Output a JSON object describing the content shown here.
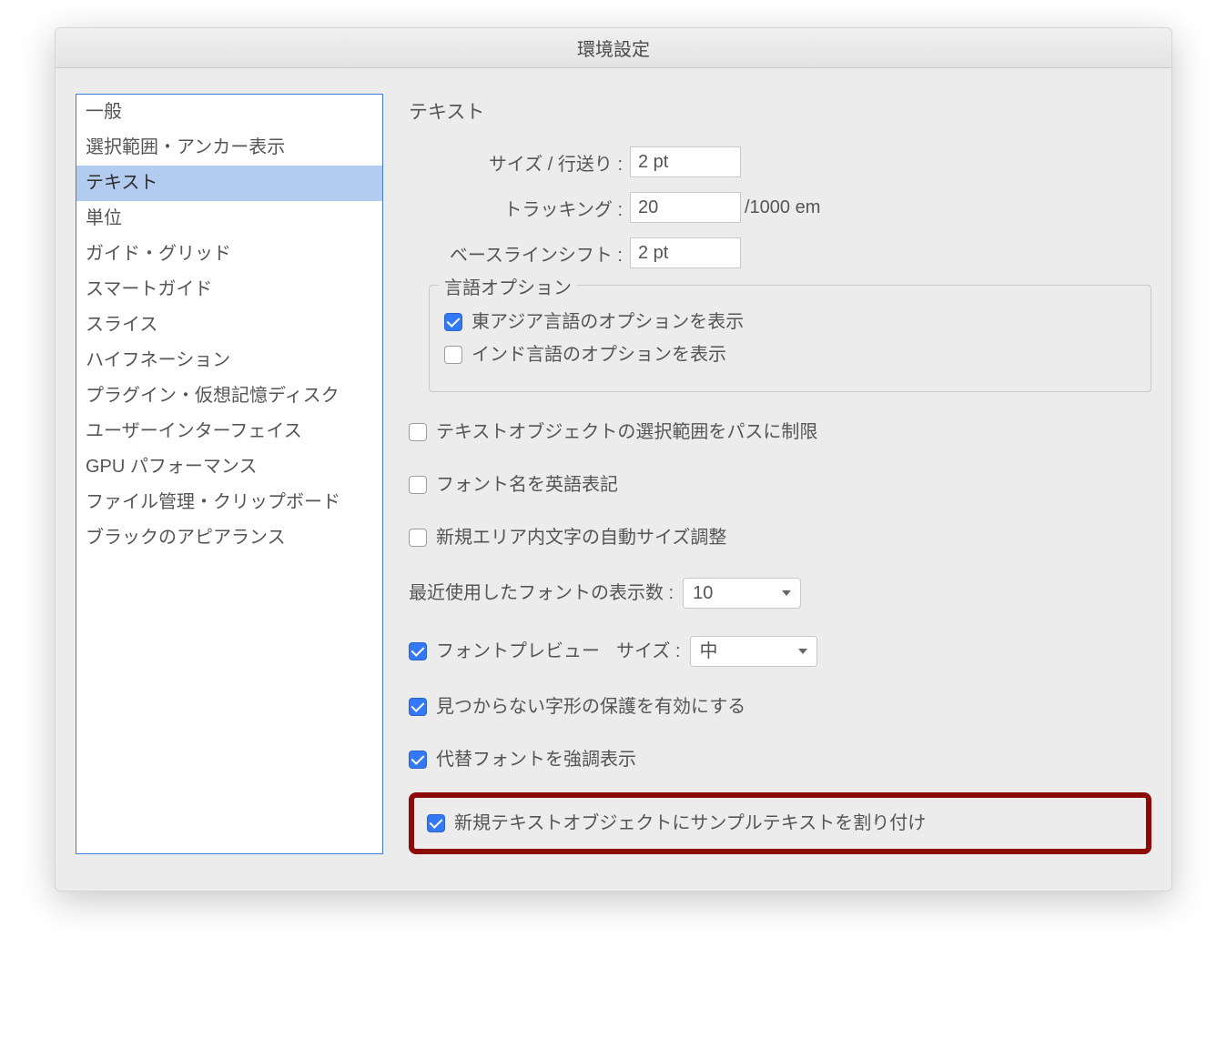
{
  "window": {
    "title": "環境設定"
  },
  "sidebar": {
    "items": [
      "一般",
      "選択範囲・アンカー表示",
      "テキスト",
      "単位",
      "ガイド・グリッド",
      "スマートガイド",
      "スライス",
      "ハイフネーション",
      "プラグイン・仮想記憶ディスク",
      "ユーザーインターフェイス",
      "GPU パフォーマンス",
      "ファイル管理・クリップボード",
      "ブラックのアピアランス"
    ],
    "selected_index": 2
  },
  "main": {
    "title": "テキスト",
    "size_leading": {
      "label": "サイズ / 行送り :",
      "value": "2 pt"
    },
    "tracking": {
      "label": "トラッキング :",
      "value": "20",
      "suffix": "/1000 em"
    },
    "baseline_shift": {
      "label": "ベースラインシフト :",
      "value": "2 pt"
    },
    "lang_options": {
      "legend": "言語オプション",
      "east_asian": {
        "label": "東アジア言語のオプションを表示",
        "checked": true
      },
      "indic": {
        "label": "インド言語のオプションを表示",
        "checked": false
      }
    },
    "restrict_path": {
      "label": "テキストオブジェクトの選択範囲をパスに制限",
      "checked": false
    },
    "font_english": {
      "label": "フォント名を英語表記",
      "checked": false
    },
    "auto_size": {
      "label": "新規エリア内文字の自動サイズ調整",
      "checked": false
    },
    "recent_fonts": {
      "label": "最近使用したフォントの表示数 :",
      "value": "10"
    },
    "font_preview": {
      "label": "フォントプレビュー",
      "checked": true,
      "size_label": "サイズ :",
      "size_value": "中"
    },
    "protect_glyphs": {
      "label": "見つからない字形の保護を有効にする",
      "checked": true
    },
    "highlight_sub": {
      "label": "代替フォントを強調表示",
      "checked": true
    },
    "fill_sample": {
      "label": "新規テキストオブジェクトにサンプルテキストを割り付け",
      "checked": true
    }
  }
}
